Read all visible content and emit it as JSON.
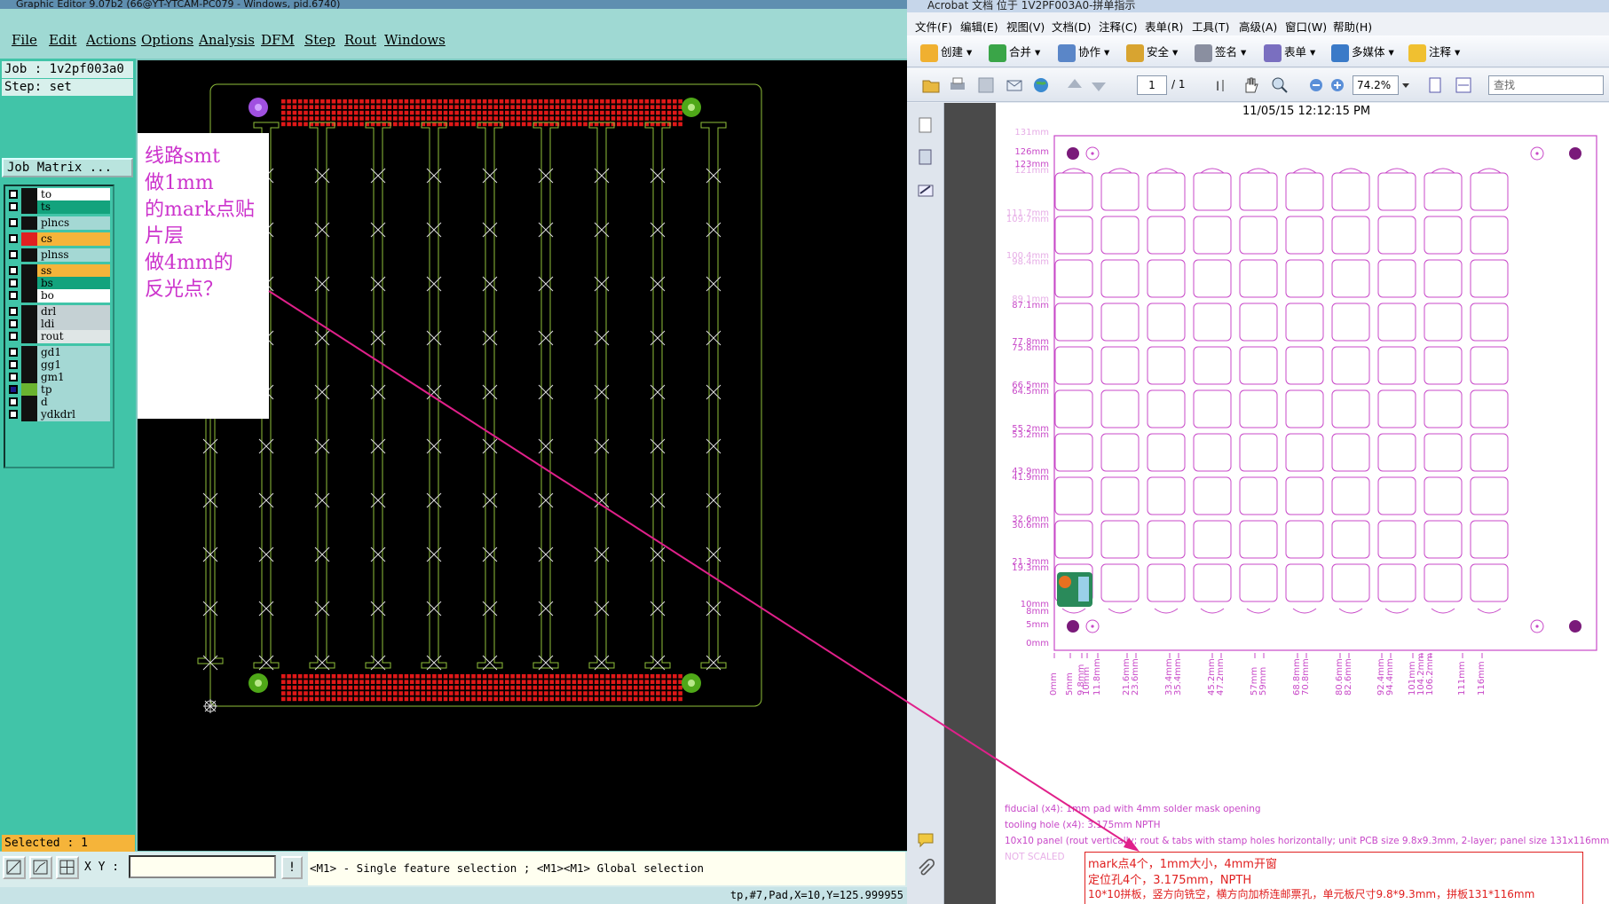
{
  "left_app": {
    "title": "Graphic Editor 9.07b2 (66@YT-YTCAM-PC079 - Windows, pid.6740)",
    "menu": [
      "File",
      "Edit",
      "Actions",
      "Options",
      "Analysis",
      "DFM",
      "Step",
      "Rout",
      "Windows"
    ],
    "job": "Job : 1v2pf003a0",
    "step": "Step: set",
    "job_matrix_button": "Job Matrix ...",
    "layers": [
      {
        "name": "to",
        "color": "#111111",
        "bg": "#ffffff"
      },
      {
        "name": "ts",
        "color": "#111111",
        "bg": "#13a37d"
      },
      {
        "name": "plncs",
        "color": "#111111",
        "bg": "#a4d8d4"
      },
      {
        "name": "cs",
        "color": "#e02020",
        "bg": "#f5b43a"
      },
      {
        "name": "plnss",
        "color": "#111111",
        "bg": "#a4d8d4"
      },
      {
        "name": "ss",
        "color": "#111111",
        "bg": "#f5b43a"
      },
      {
        "name": "bs",
        "color": "#111111",
        "bg": "#13a37d"
      },
      {
        "name": "bo",
        "color": "#111111",
        "bg": "#ffffff"
      },
      {
        "name": "drl",
        "color": "#111111",
        "bg": "#c5d1d4"
      },
      {
        "name": "ldi",
        "color": "#111111",
        "bg": "#c5d1d4"
      },
      {
        "name": "rout",
        "color": "#111111",
        "bg": "#dfe6e6"
      },
      {
        "name": "gd1",
        "color": "#111111",
        "bg": "#a4d8d4"
      },
      {
        "name": "gg1",
        "color": "#111111",
        "bg": "#a4d8d4"
      },
      {
        "name": "gm1",
        "color": "#111111",
        "bg": "#a4d8d4"
      },
      {
        "name": "tp",
        "color": "#111111",
        "bg": "#a4d8d4"
      },
      {
        "name": "d",
        "color": "#111111",
        "bg": "#a4d8d4"
      },
      {
        "name": "ydkdrl",
        "color": "#111111",
        "bg": "#a4d8d4"
      }
    ],
    "selected": "Selected : 1",
    "xy_label": "X Y :",
    "xy_value": "",
    "excl_label": "!",
    "hint": "<M1> - Single feature selection ; <M1><M1> Global selection",
    "status": "tp,#7,Pad,X=10,Y=125.999955",
    "annotation_lines": [
      "线路smt",
      "做1mm",
      "的mark点贴",
      "片层",
      "做4mm的",
      "反光点？"
    ],
    "colors": {
      "outline": "#8fbf3a",
      "pads": "#e01818",
      "fiducial_green": "#4fa818",
      "fiducial_purple": "#a050e0",
      "arrow": "#e0208a"
    }
  },
  "acrobat": {
    "title": "Acrobat 文档 位于 1V2PF003A0-拼单指示",
    "menu": [
      "文件(F)",
      "编辑(E)",
      "视图(V)",
      "文档(D)",
      "注释(C)",
      "表单(R)",
      "工具(T)",
      "高级(A)",
      "窗口(W)",
      "帮助(H)"
    ],
    "toolbar": [
      "创建",
      "合并",
      "协作",
      "安全",
      "签名",
      "表单",
      "多媒体",
      "注释"
    ],
    "page_current": "1",
    "page_total": "/ 1",
    "zoom": "74.2%",
    "search_placeholder": "查找",
    "timestamp": "11/05/15 12:12:15 PM",
    "y_dims": [
      "131mm",
      "126mm",
      "123mm",
      "121mm",
      "111.7mm",
      "109.7mm",
      "100.4mm",
      "98.4mm",
      "89.1mm",
      "87.1mm",
      "77.8mm",
      "75.8mm",
      "66.5mm",
      "64.5mm",
      "55.2mm",
      "53.2mm",
      "43.9mm",
      "41.9mm",
      "32.6mm",
      "30.6mm",
      "21.3mm",
      "19.3mm",
      "10mm",
      "8mm",
      "5mm",
      "0mm"
    ],
    "x_dims": [
      "0mm",
      "5mm",
      "9.8mm",
      "10mm",
      "11.8mm",
      "21.6mm",
      "23.6mm",
      "33.4mm",
      "35.4mm",
      "45.2mm",
      "47.2mm",
      "57mm",
      "59mm",
      "68.8mm",
      "70.8mm",
      "80.6mm",
      "82.6mm",
      "92.4mm",
      "94.4mm",
      "101mm",
      "104.2mm",
      "106.2mm",
      "111mm",
      "116mm"
    ],
    "notes": [
      "fiducial (x4): 1mm pad with 4mm solder mask opening",
      "tooling hole (x4): 3.175mm NPTH",
      "10x10 panel (rout vertically; rout & tabs with stamp holes horizontally; unit PCB size 9.8x9.3mm, 2-layer; panel size 131x116mm)",
      "NOT SCALED"
    ],
    "red_notes": [
      "mark点4个，1mm大小，4mm开窗",
      "定位孔4个，3.175mm，NPTH",
      "10*10拼板，竖方向铣空，横方向加桥连邮票孔，单元板尺寸9.8*9.3mm，拼板131*116mm"
    ],
    "colors": {
      "drawing": "#c848c8",
      "red": "#e02020"
    }
  }
}
